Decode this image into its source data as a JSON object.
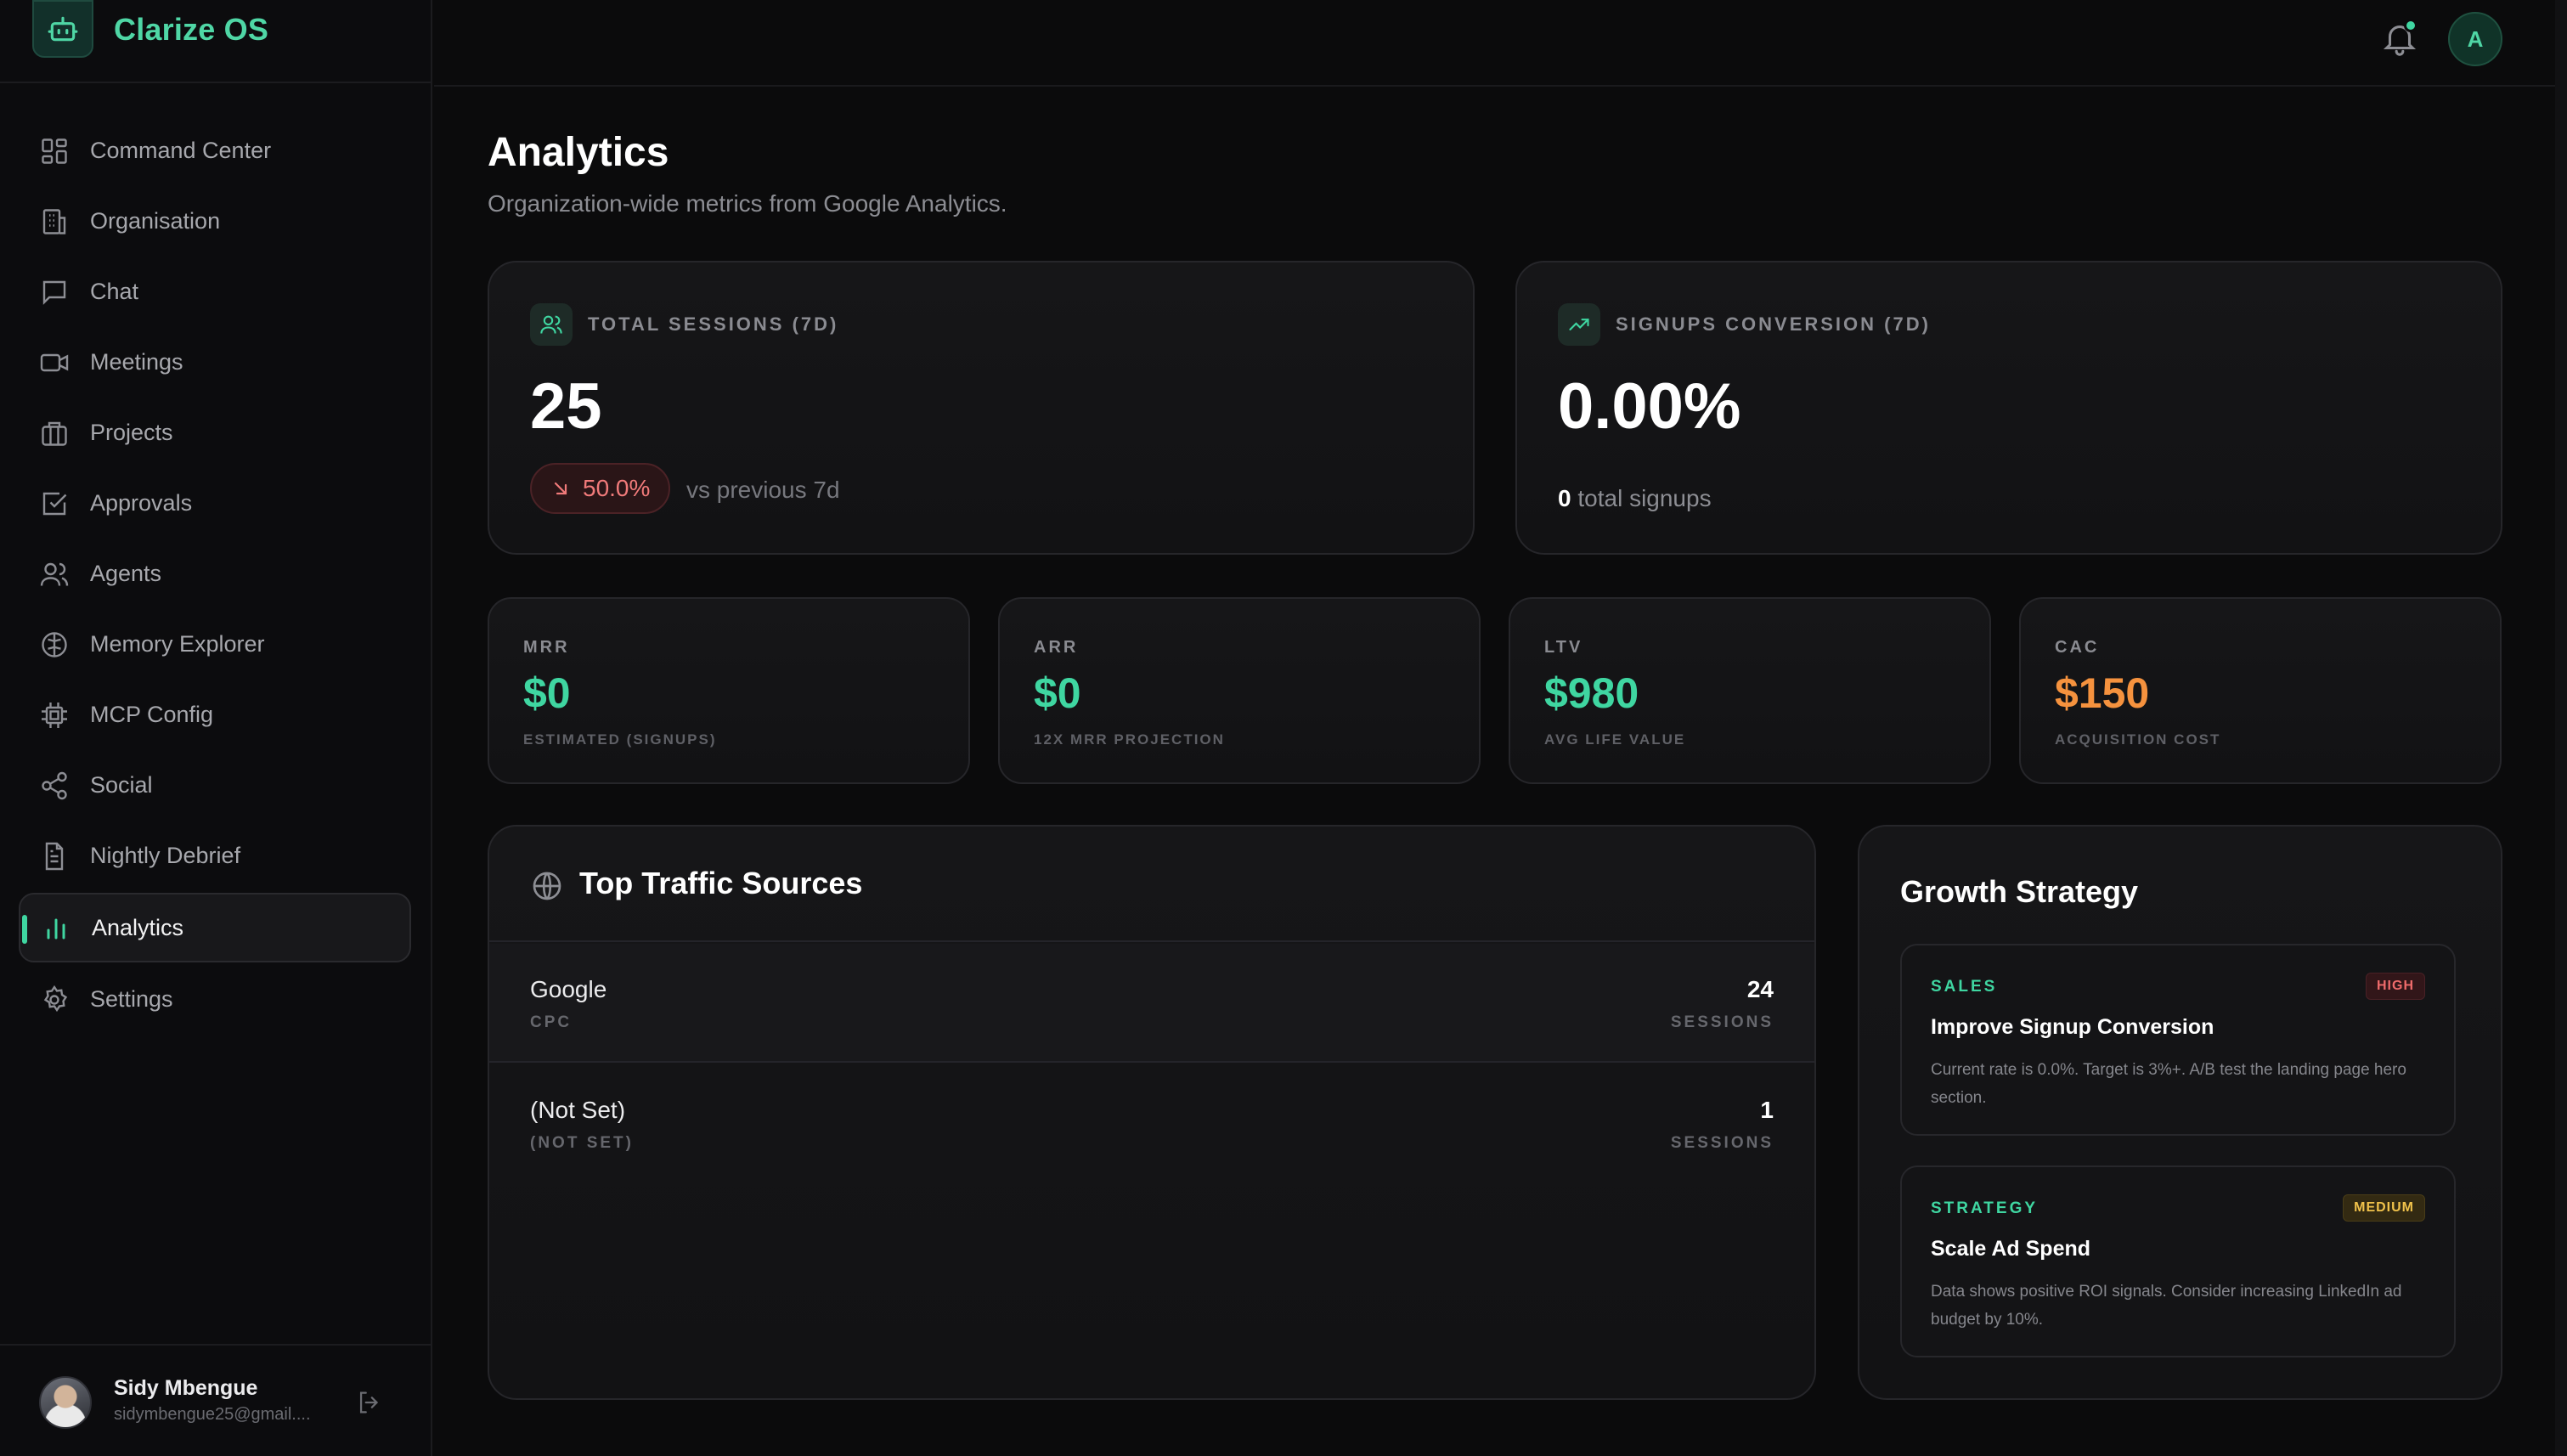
{
  "app": {
    "name": "Clarize OS"
  },
  "sidebar": {
    "items": [
      {
        "label": "Command Center",
        "icon": "grid-icon"
      },
      {
        "label": "Organisation",
        "icon": "building-icon"
      },
      {
        "label": "Chat",
        "icon": "chat-bubble-icon"
      },
      {
        "label": "Meetings",
        "icon": "video-camera-icon"
      },
      {
        "label": "Projects",
        "icon": "briefcase-icon"
      },
      {
        "label": "Approvals",
        "icon": "checkbox-icon"
      },
      {
        "label": "Agents",
        "icon": "users-icon"
      },
      {
        "label": "Memory Explorer",
        "icon": "brain-icon"
      },
      {
        "label": "MCP Config",
        "icon": "chip-icon"
      },
      {
        "label": "Social",
        "icon": "share-icon"
      },
      {
        "label": "Nightly Debrief",
        "icon": "document-icon"
      },
      {
        "label": "Analytics",
        "icon": "bar-chart-icon",
        "active": true
      },
      {
        "label": "Settings",
        "icon": "gear-icon"
      }
    ],
    "user": {
      "name": "Sidy Mbengue",
      "email": "sidymbengue25@gmail...."
    }
  },
  "topbar": {
    "avatar_initial": "A"
  },
  "page": {
    "title": "Analytics",
    "subtitle": "Organization-wide metrics from Google Analytics."
  },
  "kpis": {
    "sessions": {
      "label": "TOTAL SESSIONS (7D)",
      "value": "25",
      "change": "50.0%",
      "change_context": "vs previous 7d"
    },
    "conversion": {
      "label": "SIGNUPS CONVERSION (7D)",
      "value": "0.00%",
      "signups_count": "0",
      "signups_suffix": "total signups"
    }
  },
  "metrics": [
    {
      "label": "MRR",
      "value": "$0",
      "sub": "ESTIMATED (SIGNUPS)",
      "color": "#3fd6a1"
    },
    {
      "label": "ARR",
      "value": "$0",
      "sub": "12X MRR PROJECTION",
      "color": "#3fd6a1"
    },
    {
      "label": "LTV",
      "value": "$980",
      "sub": "AVG LIFE VALUE",
      "color": "#3fd6a1"
    },
    {
      "label": "CAC",
      "value": "$150",
      "sub": "ACQUISITION COST",
      "color": "#f5923e"
    }
  ],
  "traffic": {
    "title": "Top Traffic Sources",
    "rows": [
      {
        "name": "Google",
        "medium": "CPC",
        "count": "24",
        "unit": "SESSIONS"
      },
      {
        "name": "(Not Set)",
        "medium": "(NOT SET)",
        "count": "1",
        "unit": "SESSIONS"
      }
    ]
  },
  "growth": {
    "title": "Growth Strategy",
    "items": [
      {
        "category": "SALES",
        "priority": "HIGH",
        "title": "Improve Signup Conversion",
        "description": "Current rate is 0.0%. Target is 3%+. A/B test the landing page hero section."
      },
      {
        "category": "STRATEGY",
        "priority": "MEDIUM",
        "title": "Scale Ad Spend",
        "description": "Data shows positive ROI signals. Consider increasing LinkedIn ad budget by 10%."
      }
    ]
  }
}
